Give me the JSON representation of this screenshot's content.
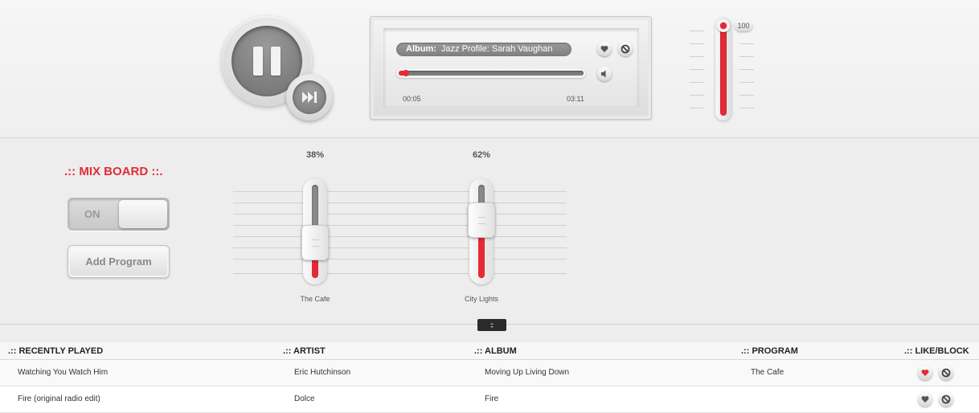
{
  "player": {
    "album_label": "Album:",
    "album_value": "Jazz Profile: Sarah Vaughan",
    "progress": 0.04,
    "elapsed": "00:05",
    "duration": "03:11",
    "volume": "100",
    "volume_level": 1.0,
    "icons": {
      "play_pause": "pause-icon",
      "skip": "skip-forward-icon",
      "like": "heart-icon",
      "block": "block-icon",
      "speaker": "speaker-icon"
    }
  },
  "mixboard": {
    "title": ".:: MIX BOARD ::.",
    "toggle_label": "ON",
    "add_program_label": "Add Program",
    "faders": [
      {
        "label": "The Cafe",
        "percent_text": "38%",
        "value": 0.38
      },
      {
        "label": "City Lights",
        "percent_text": "62%",
        "value": 0.62
      }
    ]
  },
  "table": {
    "headers": {
      "track": ".:: RECENTLY PLAYED",
      "artist": ".:: ARTIST",
      "album": ".:: ALBUM",
      "program": ".:: PROGRAM",
      "like_block": ".:: LIKE/BLOCK"
    },
    "rows": [
      {
        "track": "Watching You Watch Him",
        "artist": "Eric Hutchinson",
        "album": "Moving Up Living Down",
        "program": "The Cafe",
        "liked": true
      },
      {
        "track": "Fire (original radio edit)",
        "artist": "Dolce",
        "album": "Fire",
        "program": "",
        "liked": false
      }
    ]
  },
  "colors": {
    "accent": "#e52a36",
    "panel": "#ededed",
    "dark_button": "#6f6f6f"
  }
}
